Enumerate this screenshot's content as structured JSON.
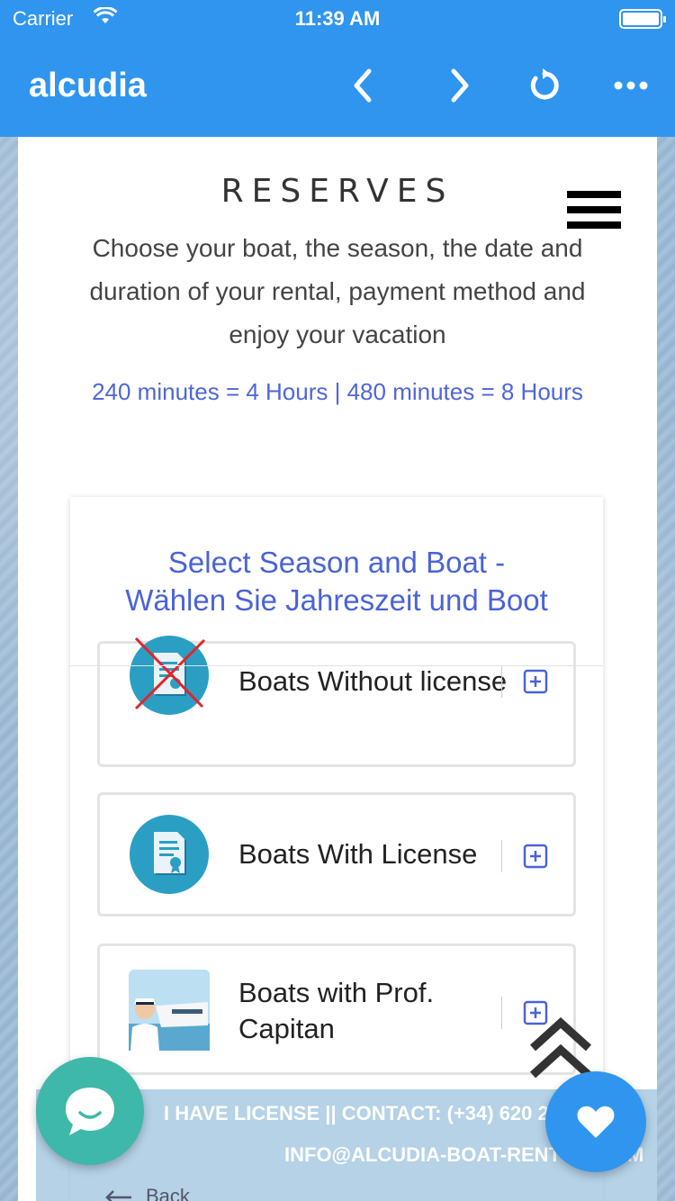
{
  "status_bar": {
    "carrier": "Carrier",
    "time": "11:39 AM"
  },
  "app_bar": {
    "title": "alcudia",
    "icons": [
      "chevron-left-icon",
      "chevron-right-icon",
      "reload-icon",
      "more-icon"
    ],
    "color": "#2f95ef"
  },
  "page": {
    "heading": "RESERVES",
    "intro": "Choose your boat, the season, the date and duration of your rental, payment method and enjoy your vacation",
    "duration_note": "240 minutes = 4 Hours | 480 minutes = 8 Hours"
  },
  "card": {
    "title": "Select Season and Boat - Wählen Sie Jahreszeit und Boot",
    "title_color": "#4a63d8",
    "categories": [
      {
        "label": "Boats Without license",
        "icon": "license-crossed-icon"
      },
      {
        "label": "Boats With License",
        "icon": "license-icon"
      },
      {
        "label": "Boats with Prof. Capitan",
        "icon": "captain-photo"
      }
    ]
  },
  "footer": {
    "line1": "I HAVE LICENSE || CONTACT: (+34) 620 2",
    "line2": "INFO@ALCUDIA-BOAT-RENT",
    "line2_end": "M",
    "back": "Back"
  },
  "floating": {
    "chat_icon": "chat-bubble-icon",
    "heart_icon": "heart-icon",
    "scroll_icon": "double-chevron-up-icon"
  }
}
